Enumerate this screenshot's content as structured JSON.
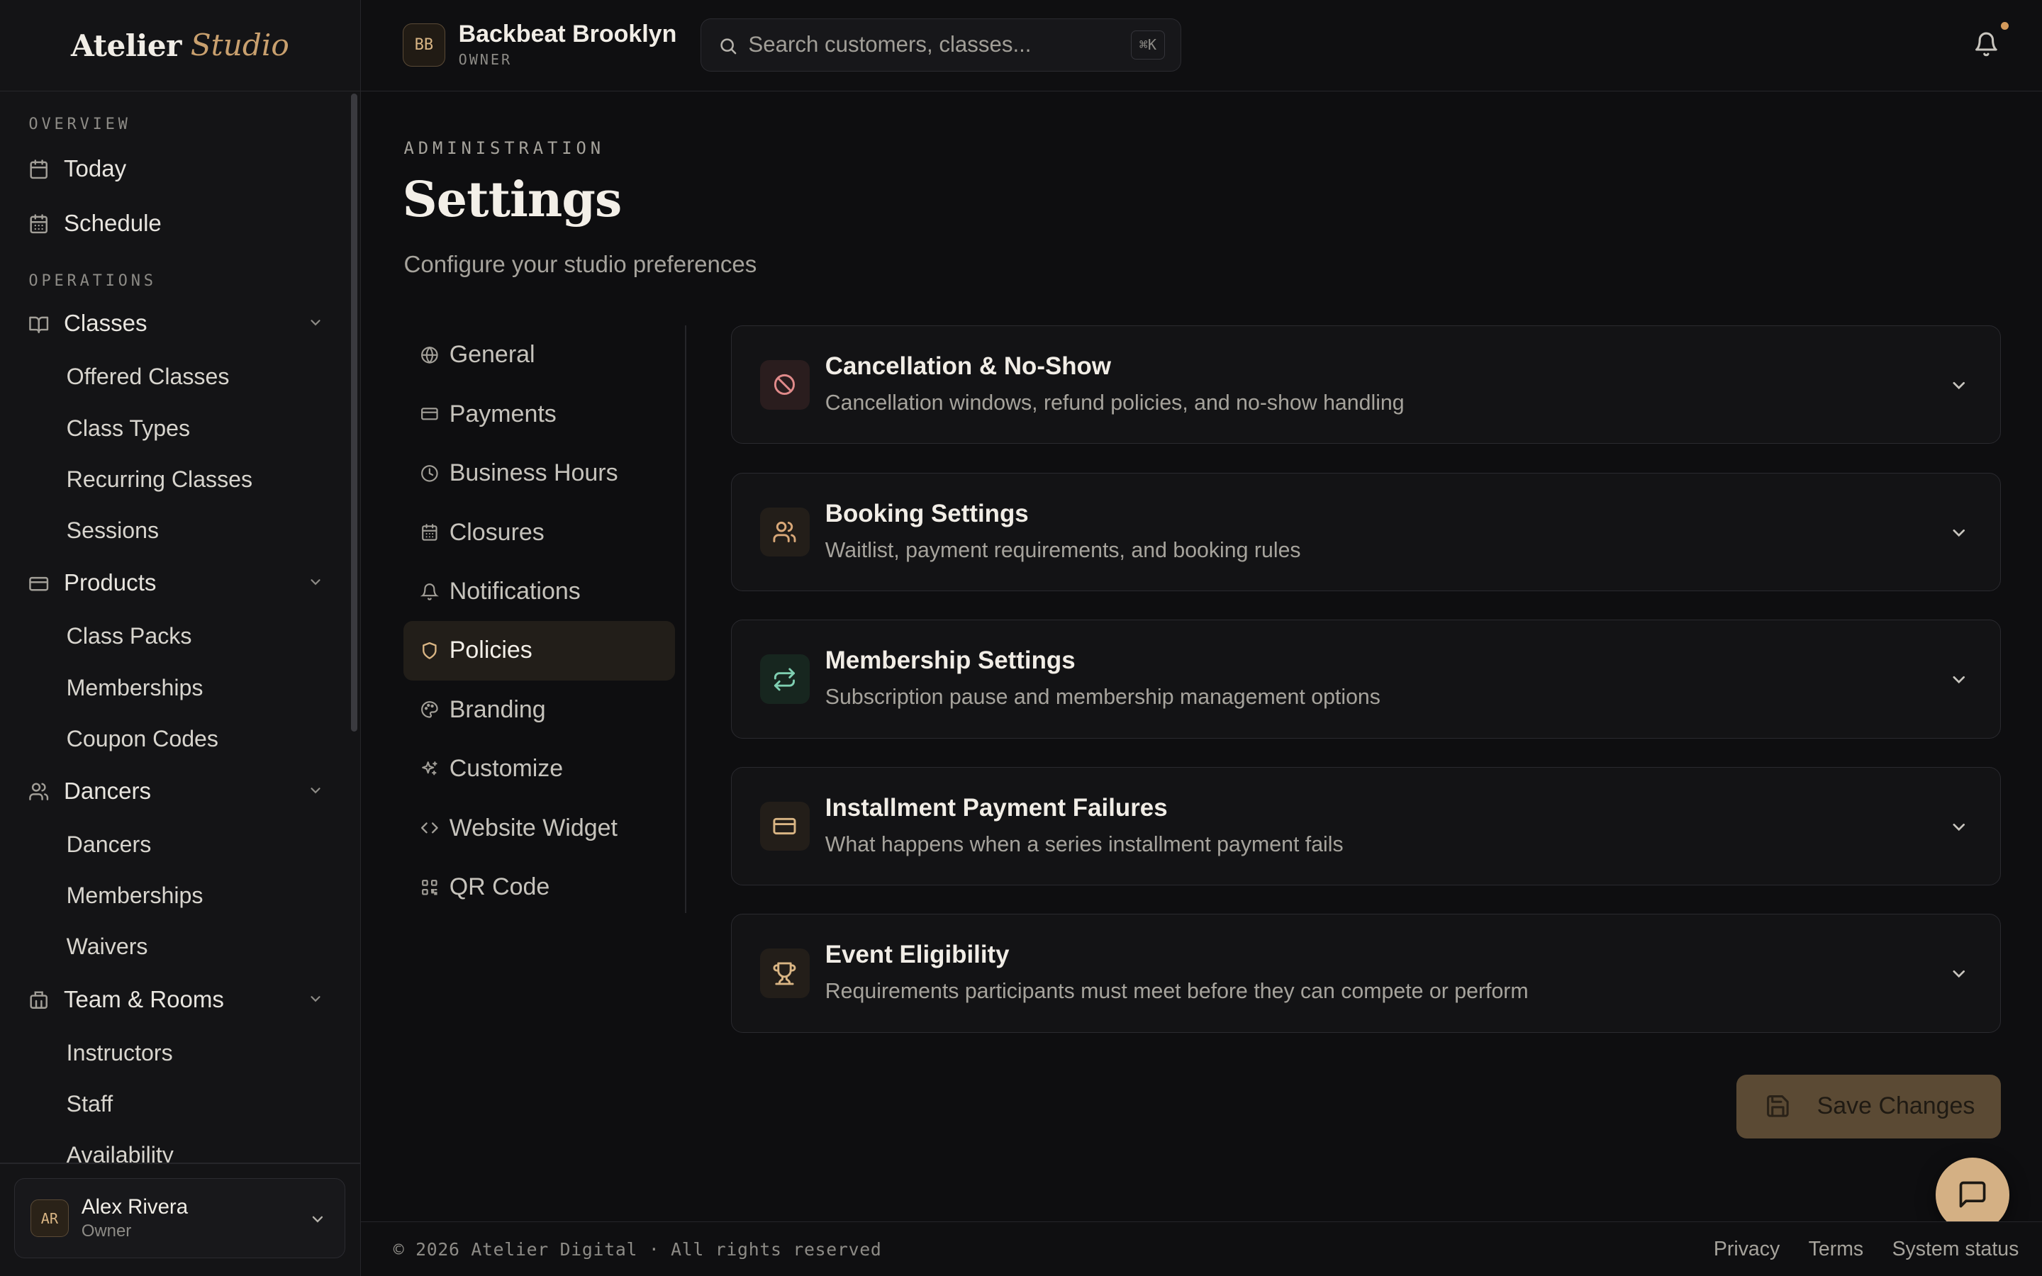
{
  "brand": {
    "name_a": "Atelier",
    "name_b": "Studio"
  },
  "topbar": {
    "org_initials": "BB",
    "org_name": "Backbeat Brooklyn",
    "org_role": "OWNER",
    "search_placeholder": "Search customers, classes...",
    "search_shortcut": "⌘K",
    "notification_icon": "bell-icon",
    "notification_dot_color": "#d39a5c"
  },
  "sidebar": {
    "sections": [
      {
        "label": "OVERVIEW",
        "items": [
          {
            "label": "Today",
            "icon": "calendar-icon"
          },
          {
            "label": "Schedule",
            "icon": "calendar-grid-icon"
          }
        ]
      },
      {
        "label": "OPERATIONS",
        "groups": [
          {
            "label": "Classes",
            "icon": "book-open-icon",
            "children": [
              "Offered Classes",
              "Class Types",
              "Recurring Classes",
              "Sessions"
            ]
          },
          {
            "label": "Products",
            "icon": "credit-card-icon",
            "children": [
              "Class Packs",
              "Memberships",
              "Coupon Codes"
            ]
          },
          {
            "label": "Dancers",
            "icon": "users-icon",
            "children": [
              "Dancers",
              "Memberships",
              "Waivers"
            ]
          },
          {
            "label": "Team & Rooms",
            "icon": "building-icon",
            "children": [
              "Instructors",
              "Staff",
              "Availability"
            ]
          }
        ]
      }
    ],
    "user": {
      "initials": "AR",
      "name": "Alex Rivera",
      "role": "Owner"
    }
  },
  "page": {
    "eyebrow": "ADMINISTRATION",
    "title": "Settings",
    "subtitle": "Configure your studio preferences"
  },
  "settings_nav": [
    {
      "label": "General",
      "icon": "globe-icon",
      "active": false
    },
    {
      "label": "Payments",
      "icon": "credit-card-icon",
      "active": false
    },
    {
      "label": "Business Hours",
      "icon": "clock-icon",
      "active": false
    },
    {
      "label": "Closures",
      "icon": "calendar-grid-icon",
      "active": false
    },
    {
      "label": "Notifications",
      "icon": "bell-icon",
      "active": false
    },
    {
      "label": "Policies",
      "icon": "shield-icon",
      "active": true
    },
    {
      "label": "Branding",
      "icon": "palette-icon",
      "active": false
    },
    {
      "label": "Customize",
      "icon": "sparkles-icon",
      "active": false
    },
    {
      "label": "Website Widget",
      "icon": "code-icon",
      "active": false
    },
    {
      "label": "QR Code",
      "icon": "qr-code-icon",
      "active": false
    }
  ],
  "policy_cards": [
    {
      "title": "Cancellation & No-Show",
      "desc": "Cancellation windows, refund policies, and no-show handling",
      "icon": "ban-icon",
      "icon_color": "#e08a8a",
      "icon_bg": "#2a1d1e"
    },
    {
      "title": "Booking Settings",
      "desc": "Waitlist, payment requirements, and booking rules",
      "icon": "users-icon",
      "icon_color": "#d9a878",
      "icon_bg": "#231e19"
    },
    {
      "title": "Membership Settings",
      "desc": "Subscription pause and membership management options",
      "icon": "repeat-icon",
      "icon_color": "#7fcfb1",
      "icon_bg": "#17261f"
    },
    {
      "title": "Installment Payment Failures",
      "desc": "What happens when a series installment payment fails",
      "icon": "credit-card-icon",
      "icon_color": "#d9b584",
      "icon_bg": "#231e19"
    },
    {
      "title": "Event Eligibility",
      "desc": "Requirements participants must meet before they can compete or perform",
      "icon": "trophy-icon",
      "icon_color": "#d9b584",
      "icon_bg": "#231e19"
    }
  ],
  "save_button": {
    "label": "Save Changes",
    "icon": "save-icon"
  },
  "chat": {
    "icon": "chat-icon"
  },
  "footer": {
    "copyright": "© 2026 Atelier Digital · All rights reserved",
    "links": [
      "Privacy",
      "Terms",
      "System status"
    ]
  }
}
